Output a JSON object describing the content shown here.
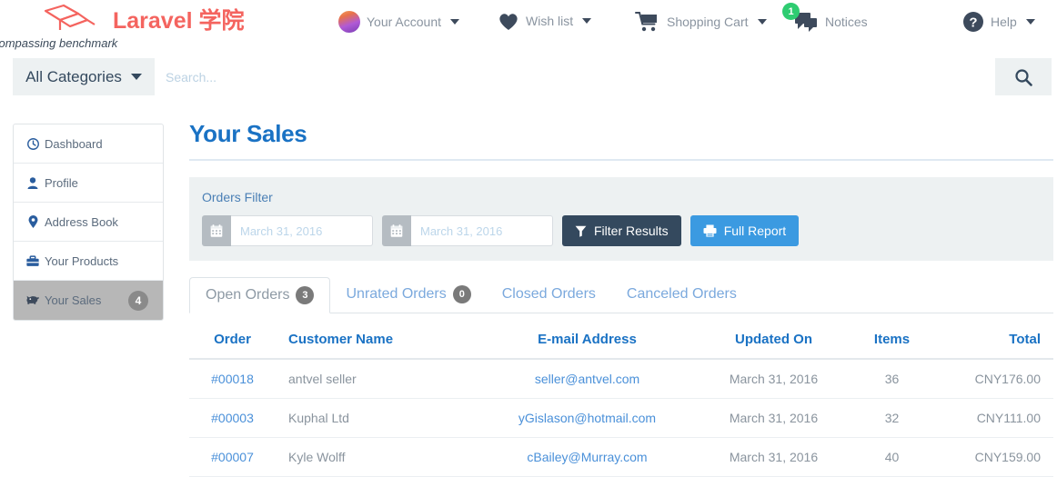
{
  "header": {
    "brand_text": "Laravel 学院",
    "tagline": "compassing benchmark",
    "nav": [
      {
        "label": "Your Account",
        "icon": "avatar-icon",
        "has_caret": true
      },
      {
        "label": "Wish list",
        "icon": "heart-icon",
        "has_caret": true
      },
      {
        "label": "Shopping Cart",
        "icon": "cart-icon",
        "has_caret": true
      },
      {
        "label": "Notices",
        "icon": "comment-icon",
        "badge": "1",
        "badge_color": "#2ecc71",
        "has_caret": false
      },
      {
        "label": "Help",
        "icon": "question-circle-icon",
        "has_caret": true
      }
    ]
  },
  "search": {
    "category_label": "All Categories",
    "placeholder": "Search...",
    "value": "",
    "button_icon": "search-icon"
  },
  "sidebar": {
    "items": [
      {
        "label": "Dashboard",
        "icon": "clock-icon",
        "active": false,
        "badge": ""
      },
      {
        "label": "Profile",
        "icon": "user-icon",
        "active": false,
        "badge": ""
      },
      {
        "label": "Address Book",
        "icon": "map-pin-icon",
        "active": false,
        "badge": ""
      },
      {
        "label": "Your Products",
        "icon": "briefcase-icon",
        "active": false,
        "badge": ""
      },
      {
        "label": "Your Sales",
        "icon": "piggy-bank-icon",
        "active": true,
        "badge": "4"
      }
    ]
  },
  "main": {
    "page_title": "Your Sales",
    "filter": {
      "legend": "Orders Filter",
      "date_from_placeholder": "March 31, 2016",
      "date_from_value": "",
      "date_to_placeholder": "March 31, 2016",
      "date_to_value": "",
      "filter_button": "Filter Results",
      "filter_button_color": "#34495e",
      "report_button": "Full Report",
      "report_button_color": "#3b9ae1"
    },
    "tabs": [
      {
        "label": "Open Orders",
        "badge": "3",
        "active": true
      },
      {
        "label": "Unrated Orders",
        "badge": "0",
        "active": false
      },
      {
        "label": "Closed Orders",
        "badge": "",
        "active": false
      },
      {
        "label": "Canceled Orders",
        "badge": "",
        "active": false
      }
    ],
    "table": {
      "columns": [
        "Order",
        "Customer Name",
        "E-mail Address",
        "Updated On",
        "Items",
        "Total"
      ],
      "rows": [
        {
          "order": "#00018",
          "customer": "antvel seller",
          "email": "seller@antvel.com",
          "updated": "March 31, 2016",
          "items": "36",
          "total": "CNY176.00"
        },
        {
          "order": "#00003",
          "customer": "Kuphal Ltd",
          "email": "yGislason@hotmail.com",
          "updated": "March 31, 2016",
          "items": "32",
          "total": "CNY111.00"
        },
        {
          "order": "#00007",
          "customer": "Kyle Wolff",
          "email": "cBailey@Murray.com",
          "updated": "March 31, 2016",
          "items": "40",
          "total": "CNY159.00"
        }
      ]
    }
  }
}
